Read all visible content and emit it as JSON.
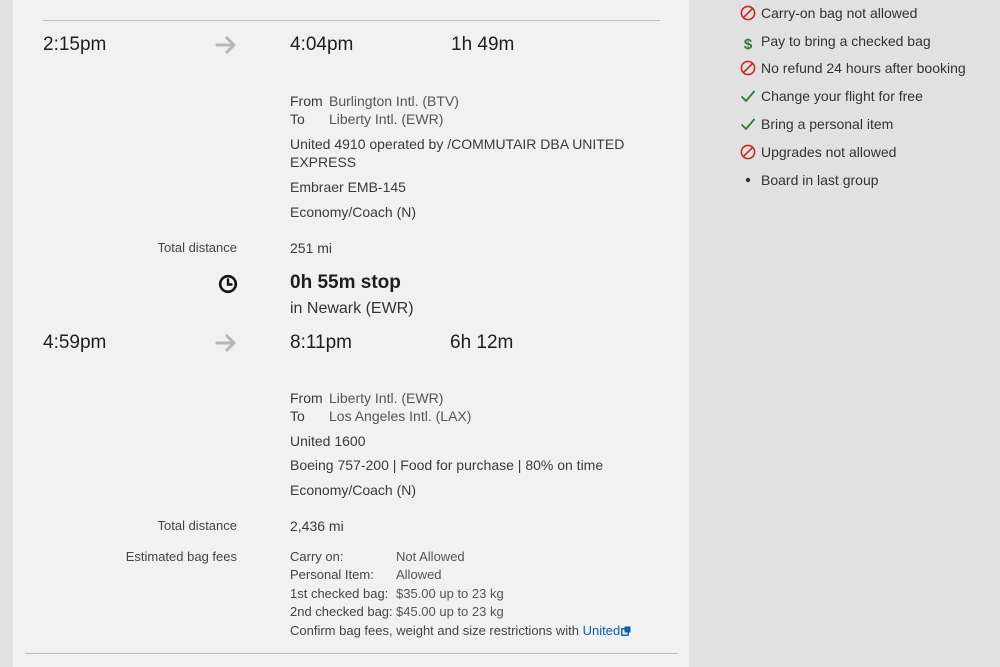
{
  "segments": [
    {
      "depart": "2:15pm",
      "arrive": "4:04pm",
      "duration": "1h 49m",
      "from_label": "From",
      "from": "Burlington Intl. (BTV)",
      "to_label": "To",
      "to": "Liberty Intl. (EWR)",
      "flight_line1": "United 4910 operated by /COMMUTAIR DBA UNITED",
      "flight_line2": "EXPRESS",
      "aircraft": "Embraer EMB-145",
      "cabin": "Economy/Coach (N)",
      "distance_label": "Total distance",
      "distance": "251 mi"
    },
    {
      "depart": "4:59pm",
      "arrive": "8:11pm",
      "duration": "6h 12m",
      "from_label": "From",
      "from": "Liberty Intl. (EWR)",
      "to_label": "To",
      "to": "Los Angeles Intl. (LAX)",
      "flight": "United 1600",
      "aircraft": "Boeing 757-200 | Food for purchase | 80% on time",
      "cabin": "Economy/Coach (N)",
      "distance_label": "Total distance",
      "distance": "2,436 mi"
    }
  ],
  "layover": {
    "duration": "0h 55m stop",
    "location": "in Newark (EWR)",
    "icon": "clock-icon"
  },
  "bag_fees": {
    "label": "Estimated bag fees",
    "rows": [
      {
        "k": "Carry on:",
        "v": "Not Allowed"
      },
      {
        "k": "Personal Item:",
        "v": "Allowed"
      },
      {
        "k": "1st checked bag:",
        "v": "$35.00 up to 23 kg"
      },
      {
        "k": "2nd checked bag:",
        "v": "$45.00 up to 23 kg"
      }
    ],
    "confirm_text": "Confirm bag fees, weight and size restrictions with",
    "confirm_link": "United"
  },
  "amenities": [
    {
      "icon": "no-icon",
      "text": "Carry-on bag not allowed"
    },
    {
      "icon": "dollar-icon",
      "text": "Pay to bring a checked bag"
    },
    {
      "icon": "no-icon",
      "text": "No refund 24 hours after booking"
    },
    {
      "icon": "check-icon",
      "text": "Change your flight for free"
    },
    {
      "icon": "check-icon",
      "text": "Bring a personal item"
    },
    {
      "icon": "no-icon",
      "text": "Upgrades not allowed"
    },
    {
      "icon": "bullet-icon",
      "text": "Board in last group"
    }
  ],
  "colors": {
    "no": "#c4282b",
    "check": "#2e7d32",
    "dollar": "#2e7d32",
    "link": "#0b5fa5"
  }
}
